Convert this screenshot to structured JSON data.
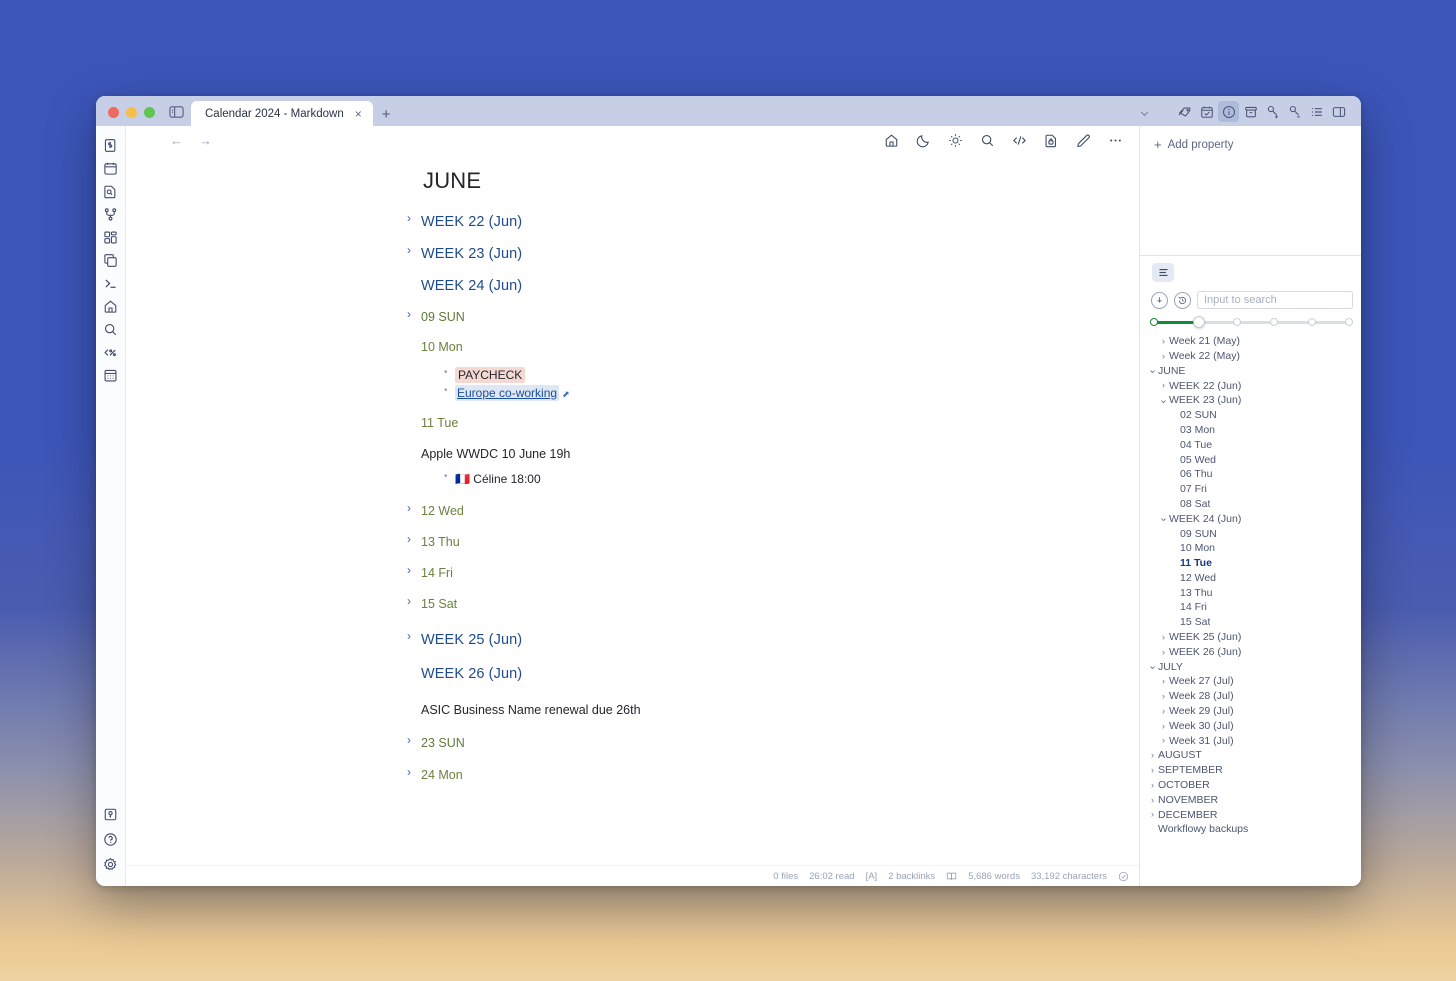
{
  "window": {
    "titlebar": {
      "sidebar_toggle_icon": "panel-left-icon",
      "tab_label": "Calendar 2024 - Markdown",
      "tab_close_label": "×",
      "new_tab_label": "+",
      "tab_overflow_icon": "chevron-down-icon"
    },
    "right_toolbar": [
      {
        "name": "tags-icon",
        "label": "Tags",
        "active": false
      },
      {
        "name": "calendar-check-icon",
        "label": "Calendar",
        "active": false
      },
      {
        "name": "info-icon",
        "label": "Info",
        "active": true
      },
      {
        "name": "archive-icon",
        "label": "Archive",
        "active": false
      },
      {
        "name": "link-add-icon",
        "label": "Add link",
        "active": false
      },
      {
        "name": "link-remove-icon",
        "label": "Remove link",
        "active": false
      },
      {
        "name": "list-icon",
        "label": "Outline",
        "active": false
      },
      {
        "name": "panel-right-icon",
        "label": "Toggle panel",
        "active": false
      }
    ]
  },
  "rail": {
    "top_items": [
      {
        "name": "file-dollar-icon",
        "label": "Finance"
      },
      {
        "name": "calendar-icon",
        "label": "Calendar"
      },
      {
        "name": "file-search-icon",
        "label": "File search"
      },
      {
        "name": "git-branch-icon",
        "label": "Versions"
      },
      {
        "name": "dashboard-icon",
        "label": "Dashboard"
      },
      {
        "name": "copy-icon",
        "label": "Duplicate"
      },
      {
        "name": "terminal-icon",
        "label": "Terminal"
      },
      {
        "name": "home-icon",
        "label": "Home"
      },
      {
        "name": "search-icon",
        "label": "Search"
      },
      {
        "name": "code-percent-icon",
        "label": "Snippets"
      },
      {
        "name": "calendar-days-icon",
        "label": "Agenda"
      }
    ],
    "bottom_items": [
      {
        "name": "plugin-icon",
        "label": "Plugins"
      },
      {
        "name": "help-icon",
        "label": "Help"
      },
      {
        "name": "settings-gear-icon",
        "label": "Settings"
      }
    ]
  },
  "editor_toolbar": {
    "back_label": "←",
    "forward_label": "→",
    "tools": [
      {
        "name": "home-icon",
        "label": "Home"
      },
      {
        "name": "moon-icon",
        "label": "Dark mode"
      },
      {
        "name": "sun-icon",
        "label": "Light mode"
      },
      {
        "name": "search-icon",
        "label": "Find"
      },
      {
        "name": "code-icon",
        "label": "Source"
      },
      {
        "name": "file-lock-icon",
        "label": "Lock file"
      },
      {
        "name": "pencil-icon",
        "label": "Edit"
      },
      {
        "name": "more-icon",
        "label": "More"
      }
    ]
  },
  "document": {
    "title": "JUNE",
    "blocks": [
      {
        "type": "week",
        "caret": true,
        "text": "WEEK 22 (Jun)"
      },
      {
        "type": "week",
        "caret": true,
        "text": "WEEK 23 (Jun)"
      },
      {
        "type": "week",
        "caret": false,
        "text": "WEEK 24 (Jun)"
      },
      {
        "type": "day",
        "caret": true,
        "text": "09 SUN"
      },
      {
        "type": "day",
        "caret": false,
        "text": "10 Mon"
      },
      {
        "type": "bullets",
        "items": [
          {
            "text": "PAYCHECK",
            "style": "highlight-red"
          },
          {
            "text": "Europe co-working",
            "style": "link",
            "external_icon": "external-link-icon"
          }
        ]
      },
      {
        "type": "day",
        "caret": false,
        "text": "11 Tue"
      },
      {
        "type": "para",
        "text": "Apple WWDC 10 June 19h"
      },
      {
        "type": "bullets",
        "indent": true,
        "items": [
          {
            "text": "🇫🇷 Céline 18:00",
            "style": "plain"
          }
        ]
      },
      {
        "type": "day",
        "caret": true,
        "text": "12 Wed"
      },
      {
        "type": "day",
        "caret": true,
        "text": "13 Thu"
      },
      {
        "type": "day",
        "caret": true,
        "text": "14 Fri"
      },
      {
        "type": "day",
        "caret": true,
        "text": "15 Sat"
      },
      {
        "type": "week",
        "caret": true,
        "text": "WEEK 25 (Jun)"
      },
      {
        "type": "week",
        "caret": false,
        "text": "WEEK 26 (Jun)"
      },
      {
        "type": "para",
        "text": "ASIC Business Name renewal due 26th"
      },
      {
        "type": "day",
        "caret": true,
        "text": "23 SUN"
      },
      {
        "type": "day",
        "caret": true,
        "text": "24 Mon"
      }
    ]
  },
  "right_sidebar": {
    "properties": {
      "add_label": "Add property",
      "add_icon": "plus-icon"
    },
    "outline": {
      "view_tab_icon": "outline-list-icon",
      "collapse_icon": "collapse-all-icon",
      "history_icon": "history-icon",
      "search_placeholder": "Input to search",
      "search_value": "",
      "depth_slider": {
        "ticks": 6,
        "value": 1,
        "fill_color": "#14893a"
      },
      "tree": [
        {
          "indent": 1,
          "caret": "right",
          "text": "Week 21 (May)",
          "current": false
        },
        {
          "indent": 1,
          "caret": "right",
          "text": "Week 22 (May)",
          "current": false
        },
        {
          "indent": 0,
          "caret": "down",
          "text": "JUNE",
          "current": false
        },
        {
          "indent": 1,
          "caret": "right",
          "text": "WEEK 22 (Jun)",
          "current": false
        },
        {
          "indent": 1,
          "caret": "down",
          "text": "WEEK 23 (Jun)",
          "current": false
        },
        {
          "indent": 2,
          "caret": "none",
          "text": "02 SUN",
          "current": false
        },
        {
          "indent": 2,
          "caret": "none",
          "text": "03 Mon",
          "current": false
        },
        {
          "indent": 2,
          "caret": "none",
          "text": "04 Tue",
          "current": false
        },
        {
          "indent": 2,
          "caret": "none",
          "text": "05 Wed",
          "current": false
        },
        {
          "indent": 2,
          "caret": "none",
          "text": "06 Thu",
          "current": false
        },
        {
          "indent": 2,
          "caret": "none",
          "text": "07 Fri",
          "current": false
        },
        {
          "indent": 2,
          "caret": "none",
          "text": "08 Sat",
          "current": false
        },
        {
          "indent": 1,
          "caret": "down",
          "text": "WEEK 24 (Jun)",
          "current": false
        },
        {
          "indent": 2,
          "caret": "none",
          "text": "09 SUN",
          "current": false
        },
        {
          "indent": 2,
          "caret": "none",
          "text": "10 Mon",
          "current": false
        },
        {
          "indent": 2,
          "caret": "none",
          "text": "11 Tue",
          "current": true
        },
        {
          "indent": 2,
          "caret": "none",
          "text": "12 Wed",
          "current": false
        },
        {
          "indent": 2,
          "caret": "none",
          "text": "13 Thu",
          "current": false
        },
        {
          "indent": 2,
          "caret": "none",
          "text": "14 Fri",
          "current": false
        },
        {
          "indent": 2,
          "caret": "none",
          "text": "15 Sat",
          "current": false
        },
        {
          "indent": 1,
          "caret": "right",
          "text": "WEEK 25 (Jun)",
          "current": false
        },
        {
          "indent": 1,
          "caret": "right",
          "text": "WEEK 26 (Jun)",
          "current": false
        },
        {
          "indent": 0,
          "caret": "down",
          "text": "JULY",
          "current": false
        },
        {
          "indent": 1,
          "caret": "right",
          "text": "Week 27 (Jul)",
          "current": false
        },
        {
          "indent": 1,
          "caret": "right",
          "text": "Week 28 (Jul)",
          "current": false
        },
        {
          "indent": 1,
          "caret": "right",
          "text": "Week 29 (Jul)",
          "current": false
        },
        {
          "indent": 1,
          "caret": "right",
          "text": "Week 30 (Jul)",
          "current": false
        },
        {
          "indent": 1,
          "caret": "right",
          "text": "Week 31 (Jul)",
          "current": false
        },
        {
          "indent": 0,
          "caret": "right",
          "text": "AUGUST",
          "current": false
        },
        {
          "indent": 0,
          "caret": "right",
          "text": "SEPTEMBER",
          "current": false
        },
        {
          "indent": 0,
          "caret": "right",
          "text": "OCTOBER",
          "current": false
        },
        {
          "indent": 0,
          "caret": "right",
          "text": "NOVEMBER",
          "current": false
        },
        {
          "indent": 0,
          "caret": "right",
          "text": "DECEMBER",
          "current": false
        },
        {
          "indent": 0,
          "caret": "none",
          "text": "Workflowy backups",
          "current": false
        }
      ]
    }
  },
  "status_bar": {
    "files": "0 files",
    "read_time": "26:02 read",
    "mode": "[A]",
    "backlinks": "2 backlinks",
    "book_icon": "book-icon",
    "words": "5,686 words",
    "characters": "33,192 characters",
    "sync_icon": "check-circle-icon"
  },
  "colors": {
    "desktop_top": "#3c55b9",
    "desktop_bottom": "#efd3a2",
    "titlebar": "#c6cfe6",
    "heading_week": "#1f4b8e",
    "heading_day": "#6b8140",
    "highlight_red": "#f4d9d3",
    "link_bg": "#dfe7f5",
    "slider_green": "#14893a",
    "active_tree": "#16397d"
  }
}
